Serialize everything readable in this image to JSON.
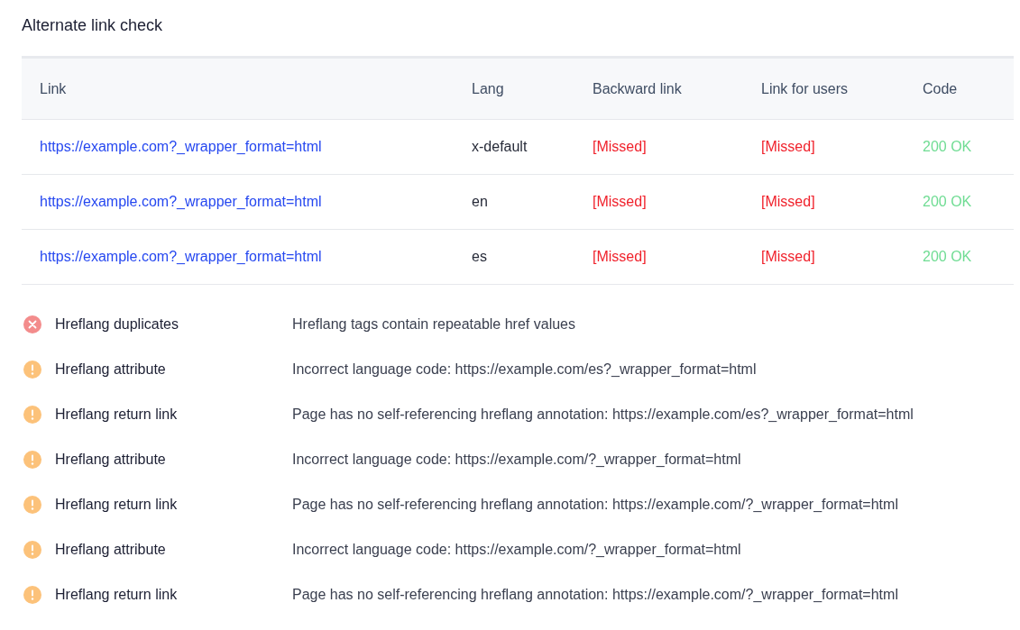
{
  "title": "Alternate link check",
  "table": {
    "columns": [
      "Link",
      "Lang",
      "Backward link",
      "Link for users",
      "Code"
    ],
    "rows": [
      {
        "link": "https://example.com?_wrapper_format=html",
        "lang": "x-default",
        "backward_link": {
          "text": "[Missed]",
          "kind": "missed"
        },
        "link_for_users": {
          "text": "[Missed]",
          "kind": "missed"
        },
        "code": {
          "text": "200 OK",
          "kind": "ok"
        }
      },
      {
        "link": "https://example.com?_wrapper_format=html",
        "lang": "en",
        "backward_link": {
          "text": "[Missed]",
          "kind": "missed"
        },
        "link_for_users": {
          "text": "[Missed]",
          "kind": "missed"
        },
        "code": {
          "text": "200 OK",
          "kind": "ok"
        }
      },
      {
        "link": "https://example.com?_wrapper_format=html",
        "lang": "es",
        "backward_link": {
          "text": "[Missed]",
          "kind": "missed"
        },
        "link_for_users": {
          "text": "[Missed]",
          "kind": "missed"
        },
        "code": {
          "text": "200 OK",
          "kind": "ok"
        }
      }
    ]
  },
  "issues": [
    {
      "kind": "error",
      "title": "Hreflang duplicates",
      "description": "Hreflang tags contain repeatable href values"
    },
    {
      "kind": "warning",
      "title": "Hreflang attribute",
      "description": "Incorrect language code: https://example.com/es?_wrapper_format=html"
    },
    {
      "kind": "warning",
      "title": "Hreflang return link",
      "description": "Page has no self-referencing hreflang annotation: https://example.com/es?_wrapper_format=html"
    },
    {
      "kind": "warning",
      "title": "Hreflang attribute",
      "description": "Incorrect language code: https://example.com/?_wrapper_format=html"
    },
    {
      "kind": "warning",
      "title": "Hreflang return link",
      "description": "Page has no self-referencing hreflang annotation: https://example.com/?_wrapper_format=html"
    },
    {
      "kind": "warning",
      "title": "Hreflang attribute",
      "description": "Incorrect language code: https://example.com/?_wrapper_format=html"
    },
    {
      "kind": "warning",
      "title": "Hreflang return link",
      "description": "Page has no self-referencing hreflang annotation: https://example.com/?_wrapper_format=html"
    }
  ]
}
